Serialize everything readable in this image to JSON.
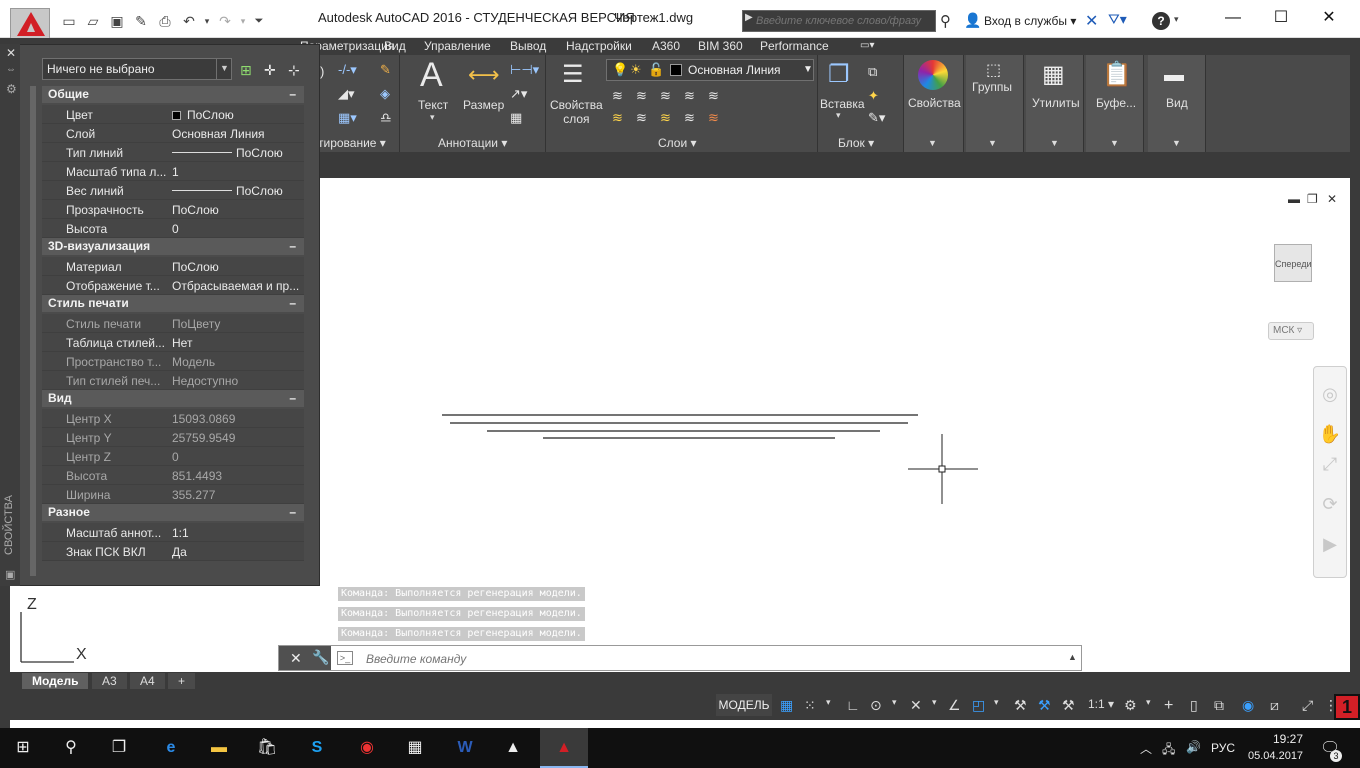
{
  "title": {
    "app": "Autodesk AutoCAD 2016 - СТУДЕНЧЕСКАЯ ВЕРСИЯ",
    "file": "Чертеж1.dwg"
  },
  "search": {
    "placeholder": "Введите ключевое слово/фразу"
  },
  "account": {
    "login": "Вход в службы"
  },
  "ribbon": {
    "tabs": [
      "Параметризация",
      "Вид",
      "Управление",
      "Вывод",
      "Надстройки",
      "A360",
      "BIM 360",
      "Performance"
    ],
    "panels": {
      "modify": "тирование",
      "annotations": "Аннотации",
      "layers": "Слои",
      "block": "Блок"
    },
    "buttons": {
      "text": "Текст",
      "dimension": "Размер",
      "layer_props_1": "Свойства",
      "layer_props_2": "слоя",
      "insert": "Вставка",
      "properties": "Свойства",
      "groups": "Группы",
      "utilities": "Утилиты",
      "clipboard": "Буфе...",
      "view": "Вид"
    },
    "current_layer": "Основная Линия"
  },
  "palette": {
    "selection": "Ничего не выбрано",
    "side_label": "СВОЙСТВА",
    "sections": [
      {
        "title": "Общие",
        "rows": [
          {
            "k": "Цвет",
            "v": "ПоСлою"
          },
          {
            "k": "Слой",
            "v": "Основная Линия"
          },
          {
            "k": "Тип линий",
            "v": "ПоСлою"
          },
          {
            "k": "Масштаб типа л...",
            "v": "1"
          },
          {
            "k": "Вес линий",
            "v": "ПоСлою"
          },
          {
            "k": "Прозрачность",
            "v": "ПоСлою"
          },
          {
            "k": "Высота",
            "v": "0"
          }
        ]
      },
      {
        "title": "3D-визуализация",
        "rows": [
          {
            "k": "Материал",
            "v": "ПоСлою"
          },
          {
            "k": "Отображение т...",
            "v": "Отбрасываемая и пр..."
          }
        ]
      },
      {
        "title": "Стиль печати",
        "rows": [
          {
            "k": "Стиль печати",
            "v": "ПоЦвету"
          },
          {
            "k": "Таблица стилей...",
            "v": "Нет"
          },
          {
            "k": "Пространство т...",
            "v": "Модель"
          },
          {
            "k": "Тип стилей печ...",
            "v": "Недоступно"
          }
        ]
      },
      {
        "title": "Вид",
        "rows": [
          {
            "k": "Центр X",
            "v": "15093.0869"
          },
          {
            "k": "Центр Y",
            "v": "25759.9549"
          },
          {
            "k": "Центр Z",
            "v": "0"
          },
          {
            "k": "Высота",
            "v": "851.4493"
          },
          {
            "k": "Ширина",
            "v": "355.277"
          }
        ]
      },
      {
        "title": "Разное",
        "rows": [
          {
            "k": "Масштаб аннот...",
            "v": "1:1"
          },
          {
            "k": "Знак ПСК ВКЛ",
            "v": "Да"
          }
        ]
      }
    ]
  },
  "viewcube": {
    "face": "Спереди",
    "ucs": "МСК"
  },
  "ucs_icon": {
    "z": "Z",
    "x": "X"
  },
  "command": {
    "history": [
      "Команда:  Выполняется регенерация модели.",
      "Команда:  Выполняется регенерация модели.",
      "Команда:  Выполняется регенерация модели."
    ],
    "placeholder": "Введите команду"
  },
  "layout_tabs": [
    "Модель",
    "A3",
    "A4",
    "+"
  ],
  "status": {
    "model": "МОДЕЛЬ",
    "scale": "1:1"
  },
  "tray": {
    "lang": "РУС",
    "time": "19:27",
    "date": "05.04.2017",
    "notif_count": "3"
  },
  "colors": {
    "accent": "#d21f26",
    "ribbon": "#4a4a4a",
    "palette": "#4b4b4b"
  }
}
